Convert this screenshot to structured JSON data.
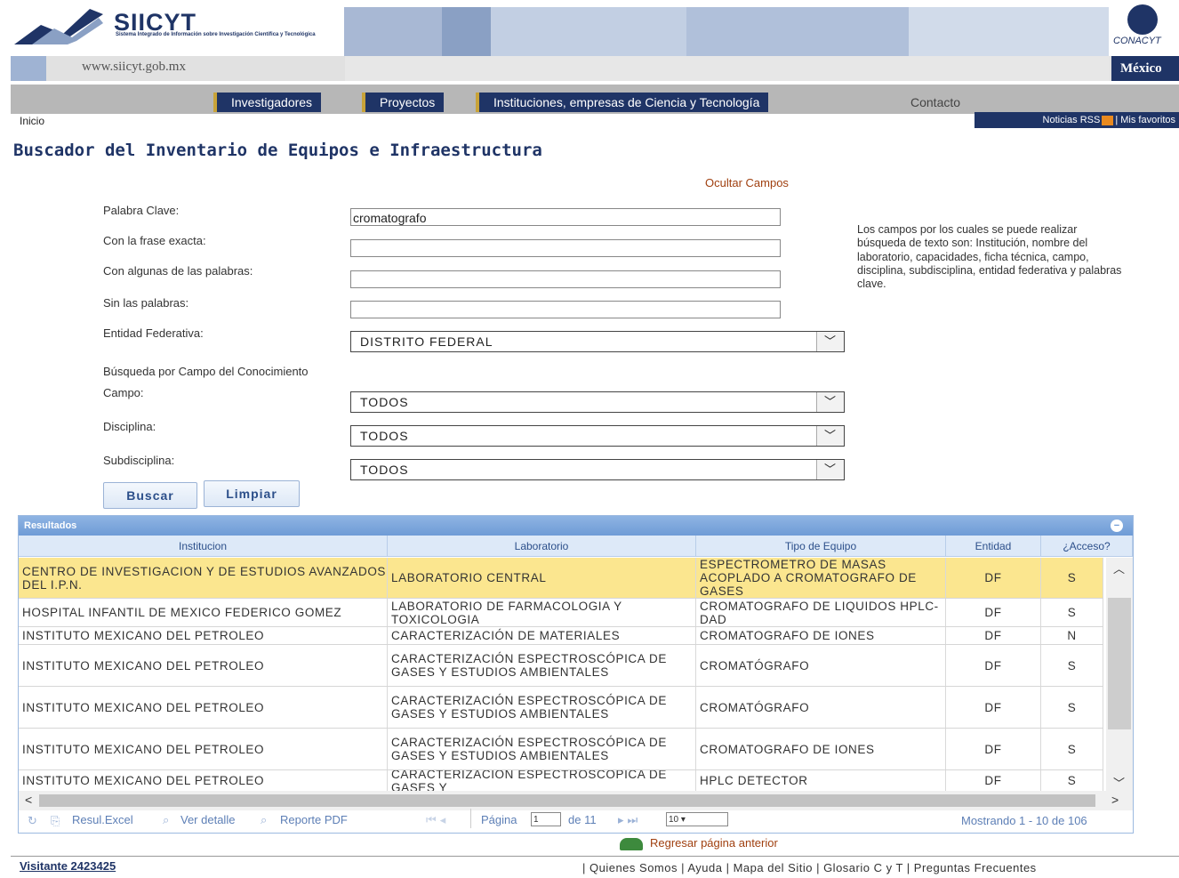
{
  "header": {
    "logo_title": "SIICYT",
    "logo_subtitle": "Sistema Integrado de Información sobre Investigación Científica y Tecnológica",
    "url": "www.siicyt.gob.mx",
    "country": "México",
    "partner_logo": "CONACYT"
  },
  "nav": {
    "tabs": [
      "Investigadores",
      "Proyectos",
      "Instituciones, empresas de Ciencia y Tecnología",
      "Contacto"
    ],
    "breadcrumb": "Inicio",
    "rss_label": "Noticias RSS",
    "favorites_label": "| Mis favoritos"
  },
  "page": {
    "title": "Buscador del Inventario de Equipos e Infraestructura",
    "hide_fields_link": "Ocultar Campos"
  },
  "form": {
    "keyword_label": "Palabra Clave:",
    "keyword_value": "cromatografo",
    "exact_phrase_label": "Con la frase exacta:",
    "exact_phrase_value": "",
    "any_words_label": "Con algunas de las palabras:",
    "any_words_value": "",
    "without_words_label": "Sin las palabras:",
    "without_words_value": "",
    "state_label": "Entidad Federativa:",
    "state_value": "DISTRITO FEDERAL",
    "knowledge_heading": "Búsqueda por Campo del Conocimiento",
    "field_label": "Campo:",
    "field_value": "TODOS",
    "discipline_label": "Disciplina:",
    "discipline_value": "TODOS",
    "subdiscipline_label": "Subdisciplina:",
    "subdiscipline_value": "TODOS",
    "search_button": "Buscar",
    "clear_button": "Limpiar",
    "help_text": "Los campos por los cuales se puede realizar búsqueda de texto son: Institución, nombre del laboratorio, capacidades, ficha técnica, campo, disciplina, subdisciplina, entidad federativa y palabras clave."
  },
  "results": {
    "caption": "Resultados",
    "columns": [
      "Institucion",
      "Laboratorio",
      "Tipo de Equipo",
      "Entidad",
      "¿Acceso?"
    ],
    "rows": [
      {
        "institucion": "CENTRO DE INVESTIGACION Y DE ESTUDIOS AVANZADOS DEL I.P.N.",
        "laboratorio": "LABORATORIO CENTRAL",
        "tipo": "ESPECTROMETRO DE MASAS ACOPLADO A CROMATOGRAFO DE GASES",
        "entidad": "DF",
        "acceso": "S"
      },
      {
        "institucion": "HOSPITAL INFANTIL DE MEXICO FEDERICO GOMEZ",
        "laboratorio": "LABORATORIO DE FARMACOLOGIA Y TOXICOLOGIA",
        "tipo": "CROMATOGRAFO DE LIQUIDOS HPLC-DAD",
        "entidad": "DF",
        "acceso": "S"
      },
      {
        "institucion": "INSTITUTO MEXICANO DEL PETROLEO",
        "laboratorio": "CARACTERIZACIÓN DE MATERIALES",
        "tipo": "CROMATOGRAFO DE IONES",
        "entidad": "DF",
        "acceso": "N"
      },
      {
        "institucion": "INSTITUTO MEXICANO DEL PETROLEO",
        "laboratorio": "CARACTERIZACIÓN ESPECTROSCÓPICA DE GASES Y ESTUDIOS AMBIENTALES",
        "tipo": "CROMATÓGRAFO",
        "entidad": "DF",
        "acceso": "S"
      },
      {
        "institucion": "INSTITUTO MEXICANO DEL PETROLEO",
        "laboratorio": "CARACTERIZACIÓN ESPECTROSCÓPICA DE GASES Y ESTUDIOS AMBIENTALES",
        "tipo": "CROMATÓGRAFO",
        "entidad": "DF",
        "acceso": "S"
      },
      {
        "institucion": "INSTITUTO MEXICANO DEL PETROLEO",
        "laboratorio": "CARACTERIZACIÓN ESPECTROSCÓPICA DE GASES Y ESTUDIOS AMBIENTALES",
        "tipo": "CROMATOGRAFO DE IONES",
        "entidad": "DF",
        "acceso": "S"
      },
      {
        "institucion": "INSTITUTO MEXICANO DEL PETROLEO",
        "laboratorio": "CARACTERIZACIÓN ESPECTROSCÓPICA DE GASES Y",
        "tipo": "HPLC DETECTOR",
        "entidad": "DF",
        "acceso": "S"
      }
    ],
    "excel_link": "Resul.Excel",
    "detail_link": "Ver detalle",
    "pdf_link": "Reporte PDF",
    "page_label": "Página",
    "page_value": "1",
    "page_of": "de 11",
    "page_size": "10",
    "showing": "Mostrando 1 - 10 de 106"
  },
  "back_link": "Regresar página anterior",
  "footer": {
    "visitor": "Visitante 2423425",
    "links": "| Quienes Somos | Ayuda | Mapa del Sitio | Glosario C y T | Preguntas Frecuentes"
  },
  "colors": {
    "brand_navy": "#1f3466",
    "highlight_row": "#fbe68f",
    "grid_header": "#dde9f8",
    "link_orange": "#a04010"
  }
}
